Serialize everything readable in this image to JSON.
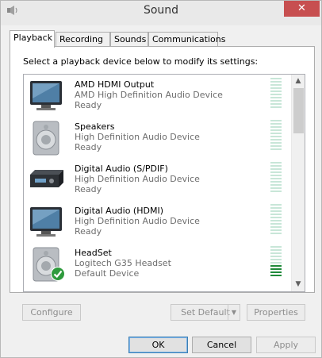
{
  "window": {
    "title": "Sound",
    "close_label": "✕"
  },
  "tabs": [
    {
      "label": "Playback",
      "active": true
    },
    {
      "label": "Recording",
      "active": false
    },
    {
      "label": "Sounds",
      "active": false
    },
    {
      "label": "Communications",
      "active": false
    }
  ],
  "playback": {
    "instruction": "Select a playback device below to modify its settings:",
    "devices": [
      {
        "name": "AMD HDMI Output",
        "description": "AMD High Definition Audio Device",
        "status": "Ready",
        "icon": "monitor-icon",
        "level_lit_bars": 0,
        "is_default": false
      },
      {
        "name": "Speakers",
        "description": "High Definition Audio Device",
        "status": "Ready",
        "icon": "speaker-icon",
        "level_lit_bars": 0,
        "is_default": false
      },
      {
        "name": "Digital Audio (S/PDIF)",
        "description": "High Definition Audio Device",
        "status": "Ready",
        "icon": "receiver-icon",
        "level_lit_bars": 0,
        "is_default": false
      },
      {
        "name": "Digital Audio (HDMI)",
        "description": "High Definition Audio Device",
        "status": "Ready",
        "icon": "monitor-icon",
        "level_lit_bars": 0,
        "is_default": false
      },
      {
        "name": "HeadSet",
        "description": "Logitech G35 Headset",
        "status": "Default Device",
        "icon": "speaker-icon",
        "level_lit_bars": 4,
        "is_default": true
      }
    ]
  },
  "buttons": {
    "configure": "Configure",
    "set_default": "Set Default",
    "properties": "Properties",
    "ok": "OK",
    "cancel": "Cancel",
    "apply": "Apply"
  },
  "colors": {
    "meter_lit": "#1f8a3a",
    "meter_unlit": "#c8e6d8",
    "close_button": "#c74f50"
  }
}
